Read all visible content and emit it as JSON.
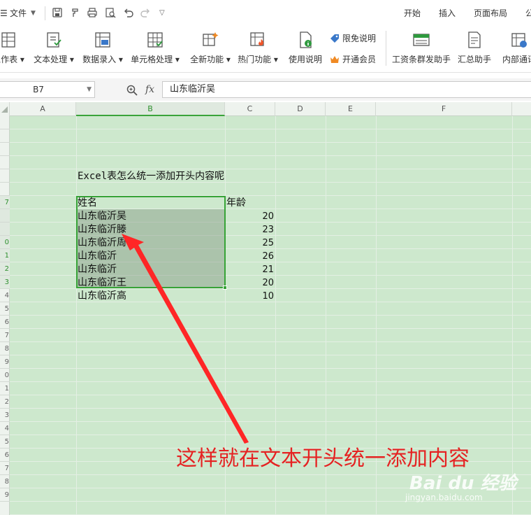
{
  "menu": {
    "file_label": "文件",
    "tabs": [
      "开始",
      "插入",
      "页面布局",
      "公"
    ]
  },
  "ribbon": {
    "buttons": [
      "工作表",
      "文本处理",
      "数据录入",
      "单元格处理",
      "全新功能",
      "热门功能",
      "使用说明",
      "工资条群发助手",
      "汇总助手",
      "内部通讯"
    ],
    "limit_free": "限免说明",
    "open_member": "开通会员"
  },
  "formula_bar": {
    "cell_ref": "B7",
    "fx_label": "fx",
    "value": "山东临沂吴"
  },
  "columns": [
    "A",
    "B",
    "C",
    "D",
    "E",
    "F"
  ],
  "rows": [
    "",
    "",
    "",
    "",
    "",
    "",
    "7",
    "",
    "",
    "0",
    "1",
    "2",
    "3",
    "4",
    "5",
    "6",
    "7",
    "8",
    "9",
    "0",
    "1",
    "2",
    "3",
    "4",
    "5",
    "6",
    "7",
    "8",
    "9"
  ],
  "sheet": {
    "title": "Excel表怎么统一添加开头内容呢",
    "header_name": "姓名",
    "header_age": "年龄",
    "names": [
      "山东临沂吴",
      "山东临沂滕",
      "山东临沂周",
      "山东临沂",
      "山东临沂",
      "山东临沂王",
      "山东临沂高"
    ],
    "ages": [
      "20",
      "23",
      "25",
      "26",
      "21",
      "20",
      "10"
    ]
  },
  "annotation": "这样就在文本开头统一添加内容",
  "watermark": {
    "logo": "Bai du 经验",
    "url": "jingyan.baidu.com"
  },
  "colors": {
    "sheet_bg": "#cde8cd",
    "selection": "#37a337",
    "annotation": "#e52222"
  }
}
